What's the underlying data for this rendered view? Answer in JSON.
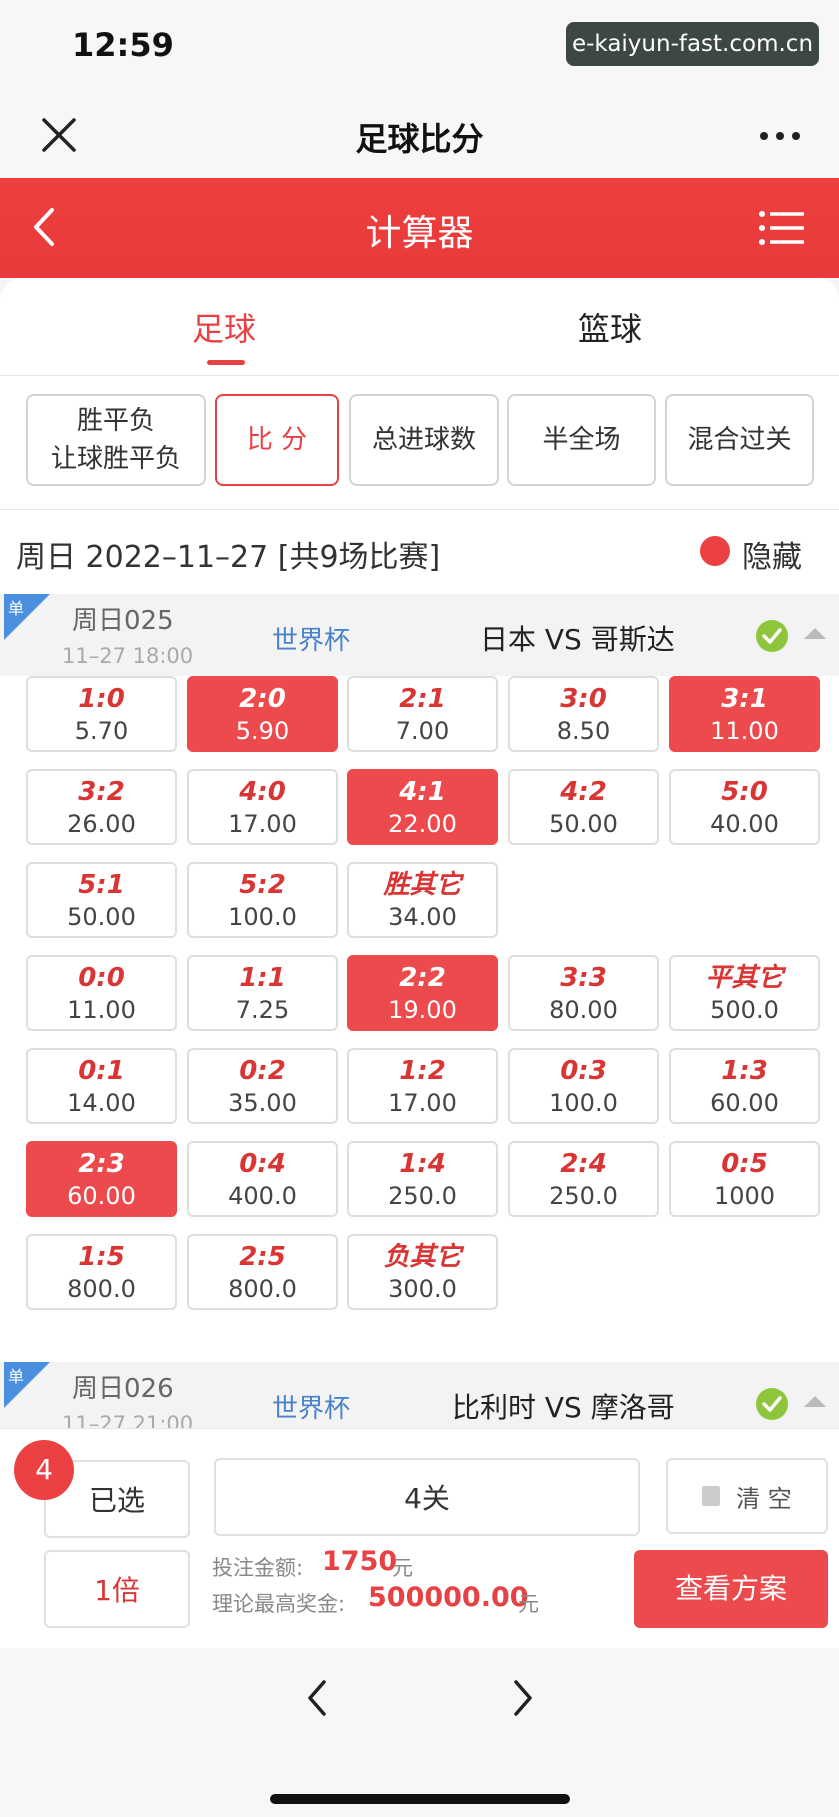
{
  "status": {
    "time": "12:59",
    "watermark": "e-kaiyun-fast.com.cn"
  },
  "nav": {
    "title": "足球比分",
    "close_icon": "close-icon",
    "more_icon": "more-icon"
  },
  "appbar": {
    "title": "计算器",
    "back_icon": "chevron-left-icon",
    "menu_icon": "list-menu-icon",
    "color": "#e83a3a"
  },
  "sport_tabs": [
    {
      "label": "足球",
      "active": true
    },
    {
      "label": "篮球",
      "active": false
    }
  ],
  "play_types": [
    {
      "line1": "胜平负",
      "line2": "让球胜平负",
      "active": false
    },
    {
      "line1": "比 分",
      "line2": "",
      "active": true
    },
    {
      "line1": "总进球数",
      "line2": "",
      "active": false
    },
    {
      "line1": "半全场",
      "line2": "",
      "active": false
    },
    {
      "line1": "混合过关",
      "line2": "",
      "active": false
    }
  ],
  "date_header": {
    "text": "周日 2022–11–27 [共9场比赛]",
    "hide_label": "隐藏"
  },
  "matches": [
    {
      "badge": "单",
      "week_no": "周日025",
      "time": "11–27 18:00",
      "league": "世界杯",
      "teams": "日本 VS 哥斯达"
    },
    {
      "badge": "单",
      "week_no": "周日026",
      "time": "11–27 21:00",
      "league": "世界杯",
      "teams": "比利时 VS 摩洛哥"
    }
  ],
  "score_odds": [
    [
      {
        "s": "1:0",
        "o": "5.70",
        "sel": false
      },
      {
        "s": "2:0",
        "o": "5.90",
        "sel": true
      },
      {
        "s": "2:1",
        "o": "7.00",
        "sel": false
      },
      {
        "s": "3:0",
        "o": "8.50",
        "sel": false
      },
      {
        "s": "3:1",
        "o": "11.00",
        "sel": true
      }
    ],
    [
      {
        "s": "3:2",
        "o": "26.00",
        "sel": false
      },
      {
        "s": "4:0",
        "o": "17.00",
        "sel": false
      },
      {
        "s": "4:1",
        "o": "22.00",
        "sel": true
      },
      {
        "s": "4:2",
        "o": "50.00",
        "sel": false
      },
      {
        "s": "5:0",
        "o": "40.00",
        "sel": false
      }
    ],
    [
      {
        "s": "5:1",
        "o": "50.00",
        "sel": false
      },
      {
        "s": "5:2",
        "o": "100.0",
        "sel": false
      },
      {
        "s": "胜其它",
        "o": "34.00",
        "sel": false
      }
    ],
    [
      {
        "s": "0:0",
        "o": "11.00",
        "sel": false
      },
      {
        "s": "1:1",
        "o": "7.25",
        "sel": false
      },
      {
        "s": "2:2",
        "o": "19.00",
        "sel": true
      },
      {
        "s": "3:3",
        "o": "80.00",
        "sel": false
      },
      {
        "s": "平其它",
        "o": "500.0",
        "sel": false
      }
    ],
    [
      {
        "s": "0:1",
        "o": "14.00",
        "sel": false
      },
      {
        "s": "0:2",
        "o": "35.00",
        "sel": false
      },
      {
        "s": "1:2",
        "o": "17.00",
        "sel": false
      },
      {
        "s": "0:3",
        "o": "100.0",
        "sel": false
      },
      {
        "s": "1:3",
        "o": "60.00",
        "sel": false
      }
    ],
    [
      {
        "s": "2:3",
        "o": "60.00",
        "sel": true
      },
      {
        "s": "0:4",
        "o": "400.0",
        "sel": false
      },
      {
        "s": "1:4",
        "o": "250.0",
        "sel": false
      },
      {
        "s": "2:4",
        "o": "250.0",
        "sel": false
      },
      {
        "s": "0:5",
        "o": "1000",
        "sel": false
      }
    ],
    [
      {
        "s": "1:5",
        "o": "800.0",
        "sel": false
      },
      {
        "s": "2:5",
        "o": "800.0",
        "sel": false
      },
      {
        "s": "负其它",
        "o": "300.0",
        "sel": false
      }
    ]
  ],
  "bottom": {
    "count": "4",
    "selected_label": "已选",
    "pass_label": "4关",
    "clear_label": "清 空",
    "multiplier_label": "1倍",
    "stake_label": "投注金额:",
    "stake_value": "1750",
    "stake_unit": "元",
    "max_label": "理论最高奖金:",
    "max_value": "500000.00",
    "max_unit": "元",
    "view_button": "查看方案"
  },
  "browser": {
    "back_icon": "chevron-left-icon",
    "forward_icon": "chevron-right-icon"
  }
}
